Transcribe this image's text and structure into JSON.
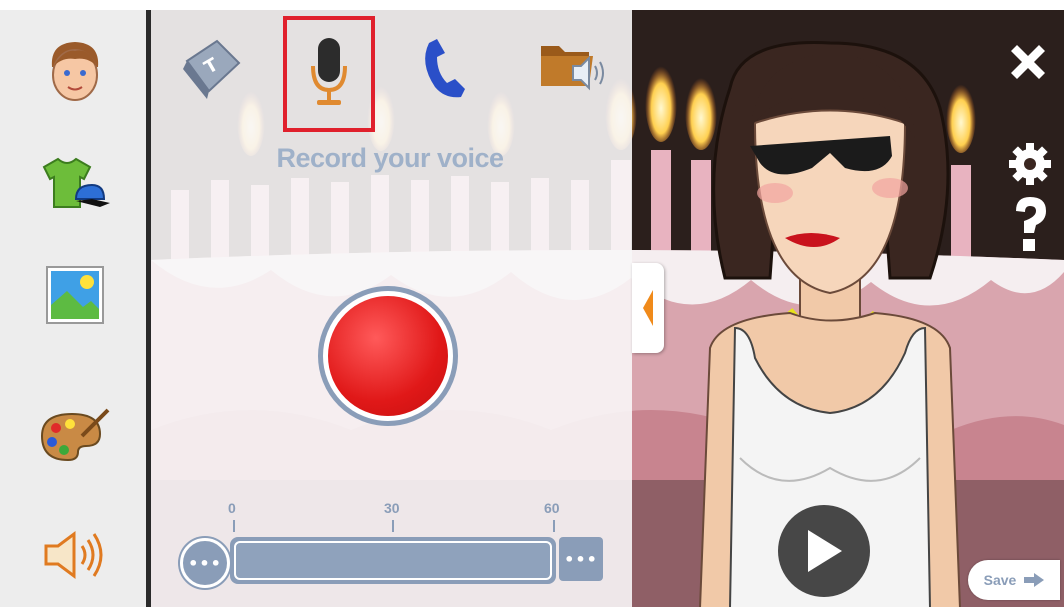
{
  "panel": {
    "title": "Record your voice",
    "tabs": [
      {
        "icon": "keyboard-key-icon"
      },
      {
        "icon": "microphone-icon",
        "selected": true
      },
      {
        "icon": "phone-icon"
      },
      {
        "icon": "audio-folder-icon"
      }
    ]
  },
  "timeline": {
    "scale": [
      "0",
      "30",
      "60"
    ],
    "left_button": "•••",
    "right_button": "•••"
  },
  "left_toolbar": {
    "items": [
      {
        "icon": "face-icon"
      },
      {
        "icon": "clothing-icon"
      },
      {
        "icon": "background-image-icon"
      },
      {
        "icon": "paint-palette-icon"
      },
      {
        "icon": "speaker-icon"
      }
    ]
  },
  "right_controls": {
    "save_label": "Save"
  },
  "colors": {
    "accent": "#8a9db8",
    "record_red": "#e01818",
    "selected_outline": "#e0202c"
  }
}
